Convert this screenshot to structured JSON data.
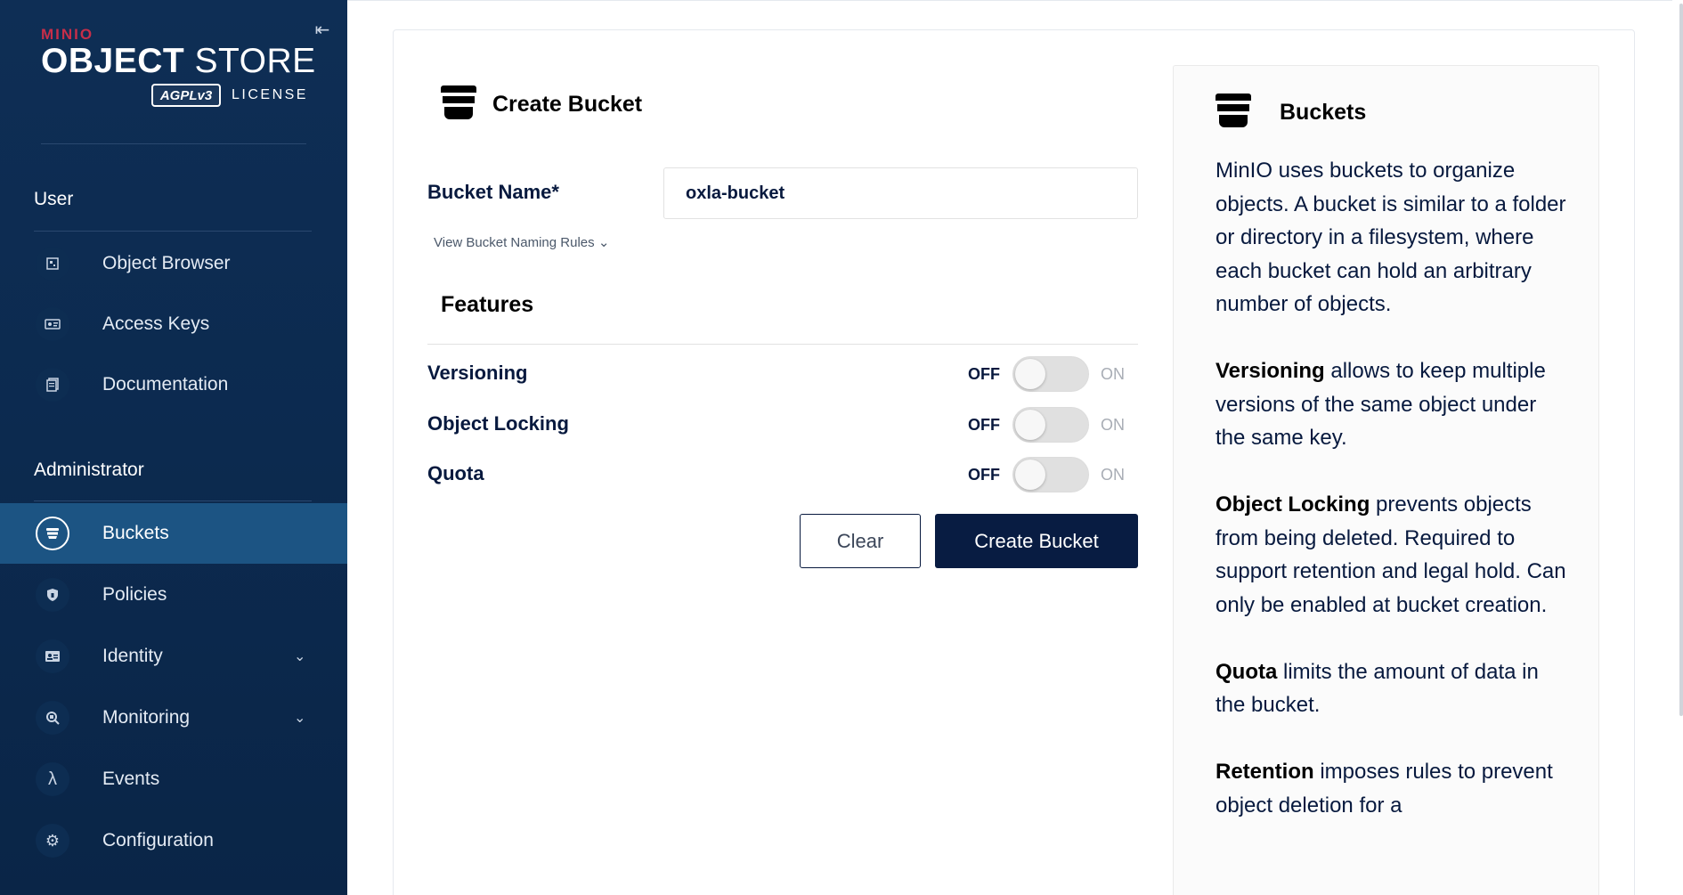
{
  "sidebar": {
    "logo": {
      "brand": "MINIO",
      "product_bold": "OBJECT",
      "product_light": "STORE",
      "badge": "AGPLv3",
      "license": "LICENSE"
    },
    "collapse_glyph": "⇤",
    "sections": {
      "user": "User",
      "admin": "Administrator"
    },
    "user_items": [
      {
        "label": "Object Browser",
        "icon": "object-browser-icon"
      },
      {
        "label": "Access Keys",
        "icon": "access-keys-icon"
      },
      {
        "label": "Documentation",
        "icon": "documentation-icon"
      }
    ],
    "admin_items": [
      {
        "label": "Buckets",
        "icon": "bucket-icon",
        "active": true
      },
      {
        "label": "Policies",
        "icon": "shield-icon"
      },
      {
        "label": "Identity",
        "icon": "id-card-icon",
        "has_children": true
      },
      {
        "label": "Monitoring",
        "icon": "magnifier-icon",
        "has_children": true
      },
      {
        "label": "Events",
        "icon": "lambda-icon"
      },
      {
        "label": "Configuration",
        "icon": "gear-icon"
      }
    ]
  },
  "form": {
    "title": "Create Bucket",
    "bucket_name_label": "Bucket Name*",
    "bucket_name_value": "oxla-bucket",
    "rules_link": "View Bucket Naming Rules",
    "features_title": "Features",
    "features": [
      {
        "label": "Versioning",
        "off": "OFF",
        "on": "ON",
        "enabled": false
      },
      {
        "label": "Object Locking",
        "off": "OFF",
        "on": "ON",
        "enabled": false
      },
      {
        "label": "Quota",
        "off": "OFF",
        "on": "ON",
        "enabled": false
      }
    ],
    "clear_label": "Clear",
    "create_label": "Create Bucket"
  },
  "help": {
    "title": "Buckets",
    "intro": "MinIO uses buckets to organize objects. A bucket is similar to a folder or directory in a filesystem, where each bucket can hold an arbitrary number of objects.",
    "versioning_term": "Versioning",
    "versioning_text": " allows to keep multiple versions of the same object under the same key.",
    "locking_term": "Object Locking",
    "locking_text": " prevents objects from being deleted. Required to support retention and legal hold. Can only be enabled at bucket creation.",
    "quota_term": "Quota",
    "quota_text": " limits the amount of data in the bucket.",
    "retention_term": "Retention",
    "retention_text": " imposes rules to prevent object deletion for a"
  },
  "colors": {
    "sidebar_bg": "#0c2a4f",
    "active_item": "#1c5483",
    "primary_button": "#081c42",
    "brand_red": "#c72e49"
  }
}
